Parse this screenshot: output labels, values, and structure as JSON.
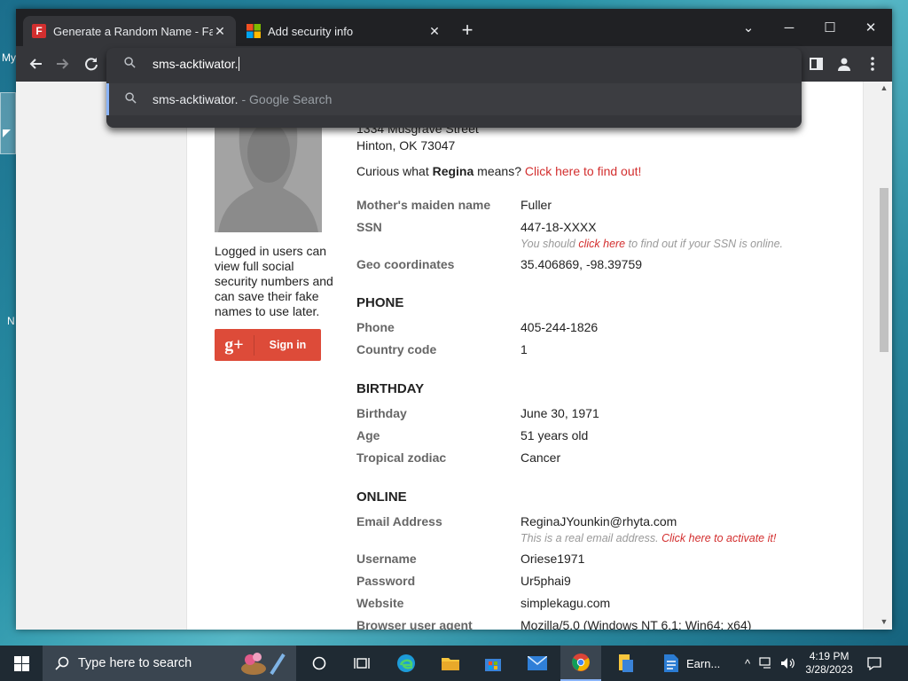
{
  "desktop": {
    "labels": [
      "My",
      "N"
    ]
  },
  "tabs": [
    {
      "title": "Generate a Random Name - Fake",
      "close": "✕",
      "active": true
    },
    {
      "title": "Add security info",
      "close": "✕",
      "active": false
    }
  ],
  "window_controls": {
    "minimize": "─",
    "maximize": "☐",
    "close": "✕",
    "dropdown": "⌄"
  },
  "omnibox": {
    "typed": "sms-acktiwator.",
    "suggestion_query": "sms-acktiwator.",
    "suggestion_suffix": "- Google Search"
  },
  "page": {
    "address_line1": "1334 Musgrave Street",
    "address_line2": "Hinton, OK 73047",
    "curious_prefix": "Curious what ",
    "name": "Regina",
    "curious_mid": " means? ",
    "curious_link": "Click here to find out!",
    "side_text": "Logged in users can view full social security numbers and can save their fake names to use later.",
    "signin_label": "Sign in",
    "mothers_maiden_label": "Mother's maiden name",
    "mothers_maiden_value": "Fuller",
    "ssn_label": "SSN",
    "ssn_value": "447-18-XXXX",
    "ssn_note_prefix": "You should ",
    "ssn_note_link": "click here",
    "ssn_note_suffix": " to find out if your SSN is online.",
    "geo_label": "Geo coordinates",
    "geo_value": "35.406869, -98.39759",
    "phone_heading": "PHONE",
    "phone_label": "Phone",
    "phone_value": "405-244-1826",
    "country_code_label": "Country code",
    "country_code_value": "1",
    "birthday_heading": "BIRTHDAY",
    "birthday_label": "Birthday",
    "birthday_value": "June 30, 1971",
    "age_label": "Age",
    "age_value": "51 years old",
    "zodiac_label": "Tropical zodiac",
    "zodiac_value": "Cancer",
    "online_heading": "ONLINE",
    "email_label": "Email Address",
    "email_value": "ReginaJYounkin@rhyta.com",
    "email_note_prefix": "This is a real email address. ",
    "email_note_link": "Click here to activate it!",
    "username_label": "Username",
    "username_value": "Oriese1971",
    "password_label": "Password",
    "password_value": "Ur5phai9",
    "website_label": "Website",
    "website_value": "simplekagu.com",
    "ua_label": "Browser user agent",
    "ua_value": "Mozilla/5.0 (Windows NT 6.1; Win64; x64)"
  },
  "taskbar": {
    "search_placeholder": "Type here to search",
    "earn_label": "Earn...",
    "time": "4:19 PM",
    "date": "3/28/2023"
  },
  "colors": {
    "link": "#d32f2f",
    "gplus": "#dd4b39",
    "chrome_dark": "#202124",
    "toolbar": "#35363a"
  }
}
